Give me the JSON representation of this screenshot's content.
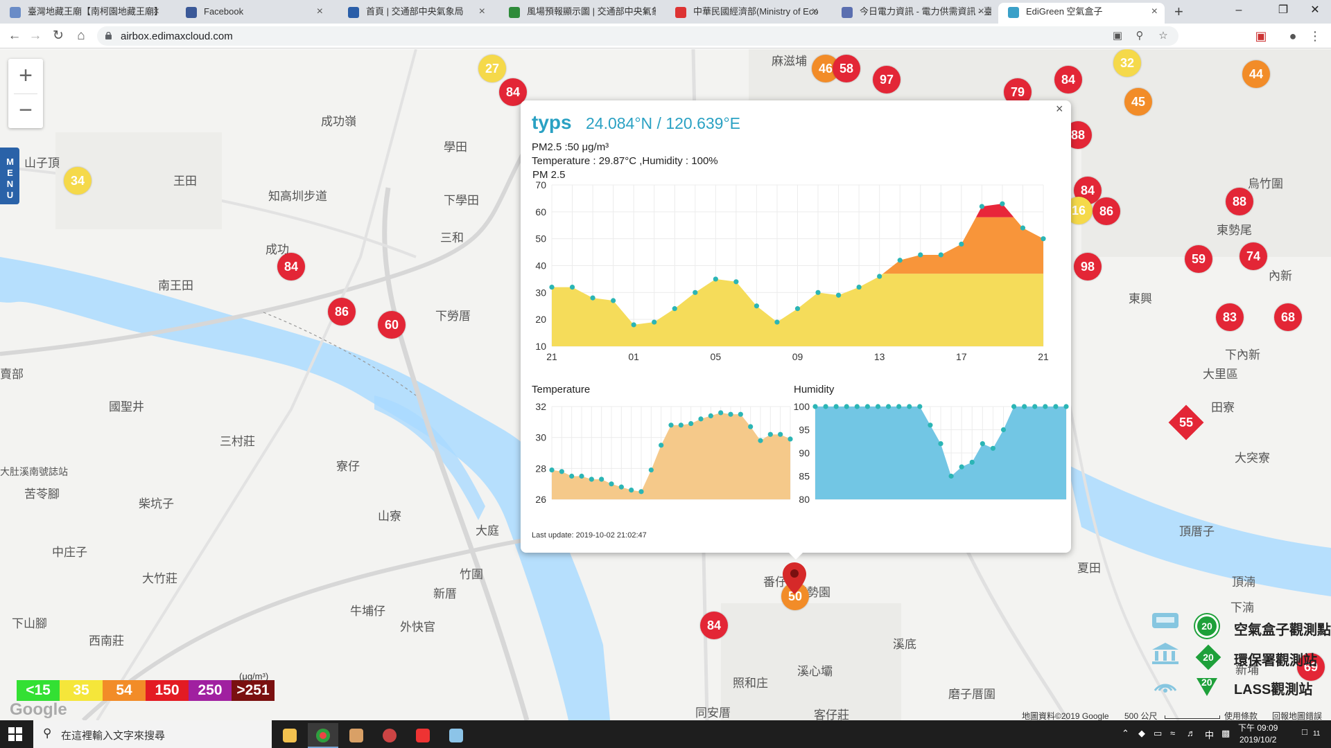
{
  "browser": {
    "tabs": [
      {
        "label": "臺灣地藏王廟【南柯園地藏王廟】",
        "color": "#6a8cc7"
      },
      {
        "label": "Facebook",
        "color": "#3b5998"
      },
      {
        "label": "首頁 | 交通部中央氣象局",
        "color": "#2a5ea8"
      },
      {
        "label": "風場預報顯示圖 | 交通部中央氣象",
        "color": "#2e8b3a"
      },
      {
        "label": "中華民國經濟部(Ministry of Eco",
        "color": "#d33"
      },
      {
        "label": "今日電力資訊 - 電力供需資訊 - 臺",
        "color": "#5b6fb0"
      },
      {
        "label": "EdiGreen 空氣盒子",
        "color": "#3aa0c8"
      }
    ],
    "url": "airbox.edimaxcloud.com"
  },
  "map": {
    "zoom_in": "+",
    "zoom_out": "−",
    "menu_label": "MENU",
    "places": [
      {
        "t": "成功嶺"
      },
      {
        "t": "學田"
      },
      {
        "t": "王田"
      },
      {
        "t": "山子頂"
      },
      {
        "t": "知高圳步道"
      },
      {
        "t": "下學田"
      },
      {
        "t": "成功"
      },
      {
        "t": "三和"
      },
      {
        "t": "南王田"
      },
      {
        "t": "下勞厝"
      },
      {
        "t": "國聖井"
      },
      {
        "t": "三村莊"
      },
      {
        "t": "寮仔"
      },
      {
        "t": "柴坑子"
      },
      {
        "t": "山寮"
      },
      {
        "t": "大庭"
      },
      {
        "t": "苦苓腳"
      },
      {
        "t": "中庄子"
      },
      {
        "t": "大竹莊"
      },
      {
        "t": "竹圍"
      },
      {
        "t": "新厝"
      },
      {
        "t": "牛埔仔"
      },
      {
        "t": "下山腳"
      },
      {
        "t": "西南莊"
      },
      {
        "t": "外快官"
      },
      {
        "t": "東勢園"
      },
      {
        "t": "溪心壩"
      },
      {
        "t": "照和庄"
      },
      {
        "t": "同安厝"
      },
      {
        "t": "客仔莊"
      },
      {
        "t": "溪底"
      },
      {
        "t": "磨子厝圍"
      },
      {
        "t": "新埔"
      },
      {
        "t": "夏田"
      },
      {
        "t": "頂厝子"
      },
      {
        "t": "大里區"
      },
      {
        "t": "田寮"
      },
      {
        "t": "東興"
      },
      {
        "t": "下內新"
      },
      {
        "t": "東勢尾"
      },
      {
        "t": "烏竹圍"
      },
      {
        "t": "內新"
      },
      {
        "t": "大突寮"
      },
      {
        "t": "頂湳"
      },
      {
        "t": "下湳"
      },
      {
        "t": "麻滋埔"
      },
      {
        "t": "番仔"
      },
      {
        "t": "賣部"
      },
      {
        "t": "大肚溪南號誌站"
      }
    ],
    "markers": [
      {
        "v": "27",
        "c": "yellow"
      },
      {
        "v": "84",
        "c": "red"
      },
      {
        "v": "46",
        "c": "orange"
      },
      {
        "v": "58",
        "c": "red"
      },
      {
        "v": "97",
        "c": "red"
      },
      {
        "v": "79",
        "c": "red"
      },
      {
        "v": "84",
        "c": "red"
      },
      {
        "v": "32",
        "c": "yellow"
      },
      {
        "v": "44",
        "c": "orange"
      },
      {
        "v": "45",
        "c": "orange"
      },
      {
        "v": "88",
        "c": "red"
      },
      {
        "v": "34",
        "c": "yellow"
      },
      {
        "v": "84",
        "c": "red"
      },
      {
        "v": "16",
        "c": "yellow"
      },
      {
        "v": "86",
        "c": "red"
      },
      {
        "v": "88",
        "c": "red"
      },
      {
        "v": "59",
        "c": "red"
      },
      {
        "v": "74",
        "c": "red"
      },
      {
        "v": "98",
        "c": "red"
      },
      {
        "v": "84",
        "c": "red"
      },
      {
        "v": "86",
        "c": "red"
      },
      {
        "v": "60",
        "c": "red"
      },
      {
        "v": "83",
        "c": "red"
      },
      {
        "v": "68",
        "c": "red"
      },
      {
        "v": "50",
        "c": "orange"
      },
      {
        "v": "84",
        "c": "red"
      },
      {
        "v": "69",
        "c": "red"
      }
    ],
    "diamond_marker": "55",
    "legend": [
      {
        "label": "<15",
        "color": "#33e033"
      },
      {
        "label": "35",
        "color": "#f5e63a"
      },
      {
        "label": "54",
        "color": "#f28c28"
      },
      {
        "label": "150",
        "color": "#e31b23"
      },
      {
        "label": "250",
        "color": "#a020a0"
      },
      {
        "label": ">251",
        "color": "#7a1010"
      }
    ],
    "legend_unit": "(μg/m³)",
    "google": "Google",
    "stations": [
      {
        "label": "空氣盒子觀測點",
        "count": "20"
      },
      {
        "label": "環保署觀測站",
        "count": "20"
      },
      {
        "label": "LASS觀測站",
        "count": "20"
      }
    ],
    "footer": {
      "map_data": "地圖資料©2019 Google",
      "scale": "500 公尺",
      "terms": "使用條款",
      "report": "回報地圖錯誤"
    }
  },
  "popup": {
    "close": "×",
    "name": "typs",
    "coord": "24.084°N / 120.639°E",
    "pm25": "PM2.5 :50 μg/m³",
    "temp_hum": "Temperature : 29.87°C ,Humidity : 100%",
    "pm_title": "PM 2.5",
    "temp_title": "Temperature",
    "hum_title": "Humidity",
    "last_update": "Last update: 2019-10-02 21:02:47"
  },
  "chart_data": [
    {
      "type": "area",
      "title": "PM 2.5",
      "x_ticks": [
        "21",
        "01",
        "05",
        "09",
        "13",
        "17",
        "21"
      ],
      "ylim": [
        10,
        70
      ],
      "y_ticks": [
        10,
        20,
        30,
        40,
        50,
        60,
        70
      ],
      "values": [
        32,
        32,
        28,
        27,
        18,
        19,
        24,
        30,
        35,
        34,
        25,
        19,
        24,
        30,
        29,
        32,
        36,
        42,
        44,
        44,
        48,
        62,
        63,
        54,
        50
      ],
      "colors": {
        "good": "#f5dc5a",
        "moderate": "#f8953a",
        "unhealthy": "#e8263a",
        "point": "#2bb5b5"
      }
    },
    {
      "type": "area",
      "title": "Temperature",
      "ylim": [
        26,
        32
      ],
      "y_ticks": [
        26,
        28,
        30,
        32
      ],
      "values": [
        27.9,
        27.8,
        27.5,
        27.5,
        27.3,
        27.3,
        27.0,
        26.8,
        26.6,
        26.5,
        27.9,
        29.5,
        30.8,
        30.8,
        30.9,
        31.2,
        31.4,
        31.6,
        31.5,
        31.5,
        30.7,
        29.8,
        30.2,
        30.2,
        29.9
      ],
      "colors": {
        "fill": "#f5c98a",
        "point": "#2bb5b5"
      }
    },
    {
      "type": "area",
      "title": "Humidity",
      "ylim": [
        80,
        100
      ],
      "y_ticks": [
        80,
        85,
        90,
        95,
        100
      ],
      "values": [
        100,
        100,
        100,
        100,
        100,
        100,
        100,
        100,
        100,
        100,
        100,
        96,
        92,
        85,
        87,
        88,
        92,
        91,
        95,
        100,
        100,
        100,
        100,
        100,
        100
      ],
      "colors": {
        "fill": "#72c6e4",
        "point": "#2bb5b5"
      }
    }
  ],
  "taskbar": {
    "search_placeholder": "在這裡輸入文字來搜尋",
    "time": "下午 09:09",
    "date": "2019/10/2",
    "ime": "中",
    "notif": "11"
  }
}
